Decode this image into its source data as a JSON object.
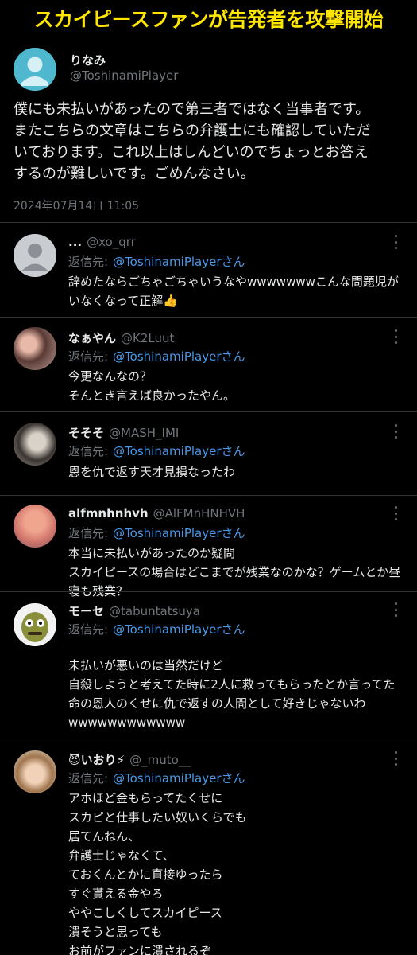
{
  "banner": {
    "title": "スカイピースファンが告発者を攻撃開始"
  },
  "main_tweet": {
    "name": "りなみ",
    "handle": "@ToshinamiPlayer",
    "text": "僕にも未払いがあったので第三者ではなく当事者です。\nまたこちらの文章はこちらの弁護士にも確認していただ\nいております。これ以上はしんどいのでちょっとお答え\nするのが難しいです。ごめんなさい。",
    "timestamp": "2024年07月14日 11:05"
  },
  "reply_label": "返信先:",
  "reply_to": "@ToshinamiPlayerさん",
  "replies": [
    {
      "name": "...",
      "handle": "@xo_qrr",
      "text": "辞めたならごちゃごちゃいうなやwwwwwwwこんな問題児が\nいなくなって正解👍"
    },
    {
      "name": "なぁやん",
      "handle": "@K2Luut",
      "text": "今更なんなの？\nそんとき言えば良かったやん。"
    },
    {
      "name": "そそそ",
      "handle": "@MASH_IMI",
      "text": "恩を仇で返す天才見損なったわ"
    },
    {
      "name": "alfmnhnhvh",
      "handle": "@AlFMnHNHVH",
      "text": "本当に未払いがあったのか疑問\nスカイピースの場合はどこまでが残業なのかな？ゲームとか昼\n寝も残業？"
    },
    {
      "name": "モーセ",
      "handle": "@tabuntatsuya",
      "text": "未払いが悪いのは当然だけど\n自殺しようと考えてた時に2人に救ってもらったとか言ってた\n命の恩人のくせに仇で返すの人間として好きじゃないわ\nwwwwwwwwwwww"
    },
    {
      "name": "😈いおり⚡",
      "handle": "@_muto__",
      "text": "アホほど金もらってたくせに\nスカピと仕事したい奴いくらでも\n居てんねん、\n弁護士じゃなくて、\nておくんとかに直接ゆったら\nすぐ貰える金やろ\nややこしくしてスカイピース\n潰そうと思っても\nお前がファンに潰されるぞ"
    }
  ]
}
